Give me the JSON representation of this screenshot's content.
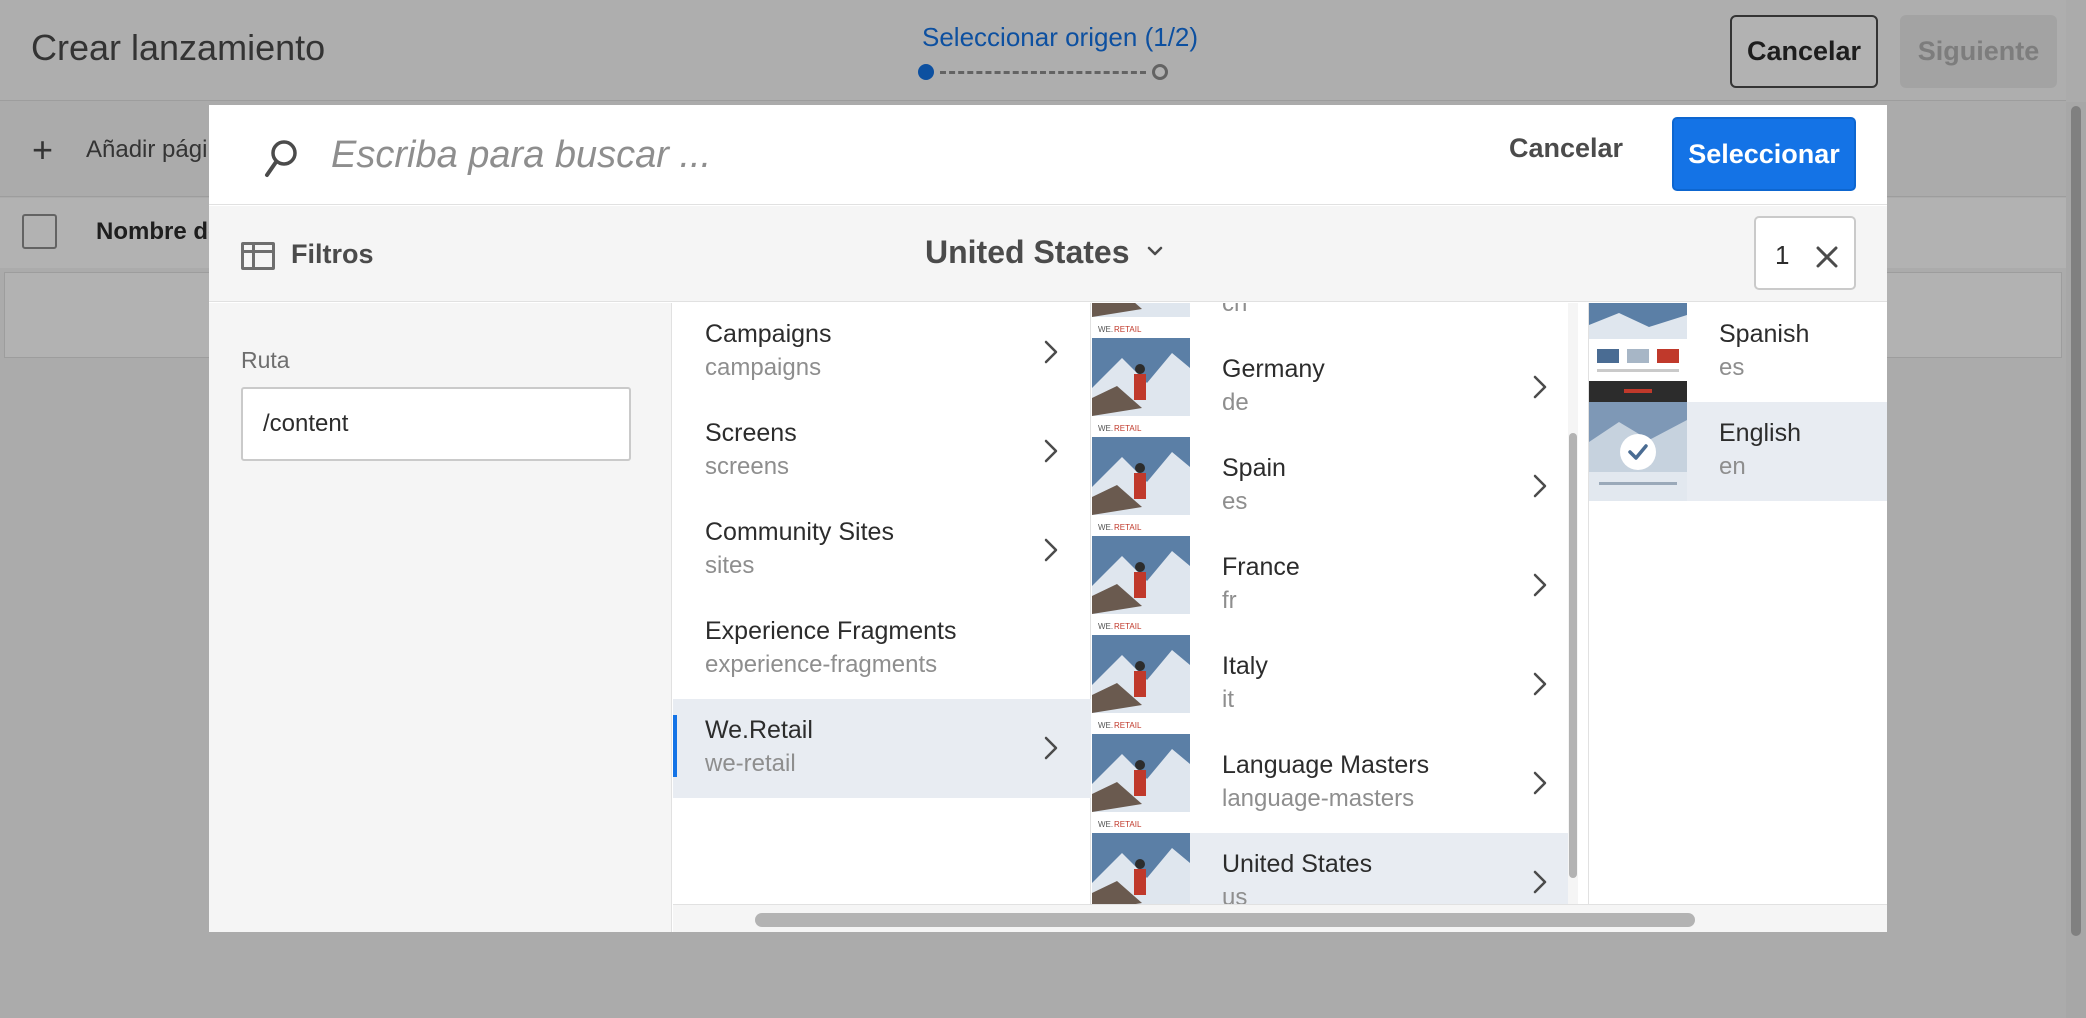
{
  "page": {
    "title": "Crear lanzamiento",
    "stepper_label": "Seleccionar origen (1/2)",
    "cancel_label": "Cancelar",
    "next_label": "Siguiente",
    "add_label": "Añadir págin",
    "column_header": "Nombre de"
  },
  "dialog": {
    "search_placeholder": "Escriba para buscar ...",
    "cancel_label": "Cancelar",
    "select_label": "Seleccionar",
    "filters_label": "Filtros",
    "breadcrumb": "United States",
    "selected_count": "1",
    "path_label": "Ruta",
    "path_value": "/content"
  },
  "column1": [
    {
      "title": "Campaigns",
      "name": "campaigns"
    },
    {
      "title": "Screens",
      "name": "screens"
    },
    {
      "title": "Community Sites",
      "name": "sites"
    },
    {
      "title": "Experience Fragments",
      "name": "experience-fragments"
    },
    {
      "title": "We.Retail",
      "name": "we-retail",
      "selected": true
    }
  ],
  "column2": {
    "partial_top": {
      "name": "cn"
    },
    "items": [
      {
        "title": "Germany",
        "name": "de"
      },
      {
        "title": "Spain",
        "name": "es"
      },
      {
        "title": "France",
        "name": "fr"
      },
      {
        "title": "Italy",
        "name": "it"
      },
      {
        "title": "Language Masters",
        "name": "language-masters"
      },
      {
        "title": "United States",
        "name": "us",
        "selected": true
      }
    ]
  },
  "column3": [
    {
      "title": "Spanish",
      "name": "es"
    },
    {
      "title": "English",
      "name": "en",
      "selected": true
    }
  ],
  "colors": {
    "accent": "#1473e6",
    "selected_row": "#e8ecf2",
    "overlay": "rgba(0,0,0,0.30)"
  }
}
